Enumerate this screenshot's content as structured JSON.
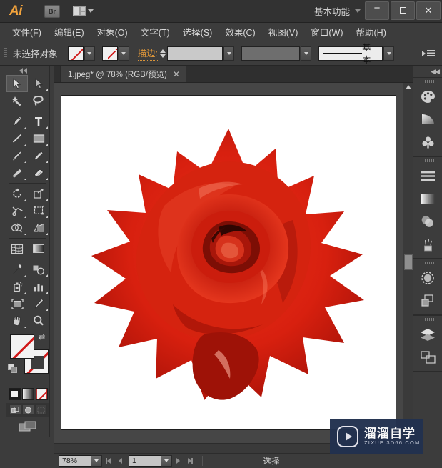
{
  "app": {
    "name": "Ai",
    "bridge_label": "Br",
    "workspace": "基本功能",
    "arrange_icon": "arrange-documents-icon",
    "window_controls": {
      "minimize": "—",
      "maximize": "□",
      "close": "✕"
    }
  },
  "menubar": {
    "items": [
      {
        "label": "文件(F)",
        "name": "menu-file"
      },
      {
        "label": "编辑(E)",
        "name": "menu-edit"
      },
      {
        "label": "对象(O)",
        "name": "menu-object"
      },
      {
        "label": "文字(T)",
        "name": "menu-type"
      },
      {
        "label": "选择(S)",
        "name": "menu-select"
      },
      {
        "label": "效果(C)",
        "name": "menu-effect"
      },
      {
        "label": "视图(V)",
        "name": "menu-view"
      },
      {
        "label": "窗口(W)",
        "name": "menu-window"
      },
      {
        "label": "帮助(H)",
        "name": "menu-help"
      }
    ]
  },
  "control_bar": {
    "selection_status": "未选择对象",
    "fill_swatch": "none",
    "stroke_swatch": "none",
    "stroke_label": "描边:",
    "stroke_weight_value": "",
    "stroke_weight_placeholder": "",
    "variable_width_value": "",
    "stroke_profile": "基本",
    "panel_menu_icon": "panel-menu-icon"
  },
  "toolbar": {
    "tools": [
      {
        "name": "selection-tool",
        "label": "选择工具",
        "selected": true
      },
      {
        "name": "direct-selection-tool",
        "label": "直接选择工具",
        "selected": false
      },
      {
        "name": "magic-wand-tool",
        "label": "魔棒工具",
        "selected": false
      },
      {
        "name": "lasso-tool",
        "label": "套索工具",
        "selected": false
      },
      {
        "name": "pen-tool",
        "label": "钢笔工具",
        "selected": false
      },
      {
        "name": "type-tool",
        "label": "文字工具",
        "selected": false
      },
      {
        "name": "line-segment-tool",
        "label": "直线段工具",
        "selected": false
      },
      {
        "name": "rectangle-tool",
        "label": "矩形工具",
        "selected": false
      },
      {
        "name": "paintbrush-tool",
        "label": "画笔工具",
        "selected": false
      },
      {
        "name": "pencil-tool",
        "label": "铅笔工具",
        "selected": false
      },
      {
        "name": "blob-brush-tool",
        "label": "斑点画笔工具",
        "selected": false
      },
      {
        "name": "eraser-tool",
        "label": "橡皮擦工具",
        "selected": false
      },
      {
        "name": "rotate-tool",
        "label": "旋转工具",
        "selected": false
      },
      {
        "name": "scale-tool",
        "label": "比例缩放工具",
        "selected": false
      },
      {
        "name": "width-tool",
        "label": "宽度工具",
        "selected": false
      },
      {
        "name": "free-transform-tool",
        "label": "自由变换工具",
        "selected": false
      },
      {
        "name": "shape-builder-tool",
        "label": "形状生成器工具",
        "selected": false
      },
      {
        "name": "perspective-grid-tool",
        "label": "透视网格工具",
        "selected": false
      },
      {
        "name": "mesh-tool",
        "label": "网格工具",
        "selected": false
      },
      {
        "name": "gradient-tool",
        "label": "渐变工具",
        "selected": false
      },
      {
        "name": "eyedropper-tool",
        "label": "吸管工具",
        "selected": false
      },
      {
        "name": "blend-tool",
        "label": "混合工具",
        "selected": false
      },
      {
        "name": "symbol-sprayer-tool",
        "label": "符号喷枪工具",
        "selected": false
      },
      {
        "name": "column-graph-tool",
        "label": "柱形图工具",
        "selected": false
      },
      {
        "name": "artboard-tool",
        "label": "画板工具",
        "selected": false
      },
      {
        "name": "slice-tool",
        "label": "切片工具",
        "selected": false
      },
      {
        "name": "hand-tool",
        "label": "抓手工具",
        "selected": false
      },
      {
        "name": "zoom-tool",
        "label": "缩放工具",
        "selected": false
      }
    ],
    "fill_state": "none",
    "stroke_state": "none",
    "swap_icon": "swap-fill-stroke-icon",
    "default_icon": "default-fill-stroke-icon",
    "color_modes": [
      {
        "name": "color-mode-button",
        "label": "颜色"
      },
      {
        "name": "gradient-mode-button",
        "label": "渐变"
      },
      {
        "name": "none-mode-button",
        "label": "无",
        "selected": true
      }
    ],
    "draw_modes": [
      {
        "name": "draw-normal-button",
        "label": "正常绘图"
      },
      {
        "name": "draw-behind-button",
        "label": "背面绘图"
      },
      {
        "name": "draw-inside-button",
        "label": "内部绘图"
      }
    ],
    "screen_mode": {
      "name": "screen-mode-button",
      "label": "更改屏幕模式"
    }
  },
  "document": {
    "tab_title": "1.jpeg* @ 78% (RGB/预览)",
    "close_glyph": "✕",
    "artboard_content": "red-rose-photo"
  },
  "status_bar": {
    "zoom_level": "78%",
    "page_number": "1",
    "status_text": "选择",
    "nav_first": "first-artboard-button",
    "nav_prev": "previous-artboard-button",
    "nav_next": "next-artboard-button",
    "nav_last": "last-artboard-button"
  },
  "dock": {
    "collapse_icon": "collapse-panels-icon",
    "groups": [
      {
        "panels": [
          {
            "name": "panel-color-icon",
            "label": "颜色"
          },
          {
            "name": "panel-color-guide-icon",
            "label": "颜色参考"
          },
          {
            "name": "panel-symbols-icon",
            "label": "符号"
          }
        ]
      },
      {
        "panels": [
          {
            "name": "panel-stroke-icon",
            "label": "描边"
          },
          {
            "name": "panel-gradient-icon",
            "label": "渐变"
          },
          {
            "name": "panel-transparency-icon",
            "label": "透明度"
          },
          {
            "name": "panel-brushes-icon",
            "label": "画笔"
          }
        ]
      },
      {
        "panels": [
          {
            "name": "panel-appearance-icon",
            "label": "外观"
          },
          {
            "name": "panel-graphic-styles-icon",
            "label": "图形样式"
          }
        ]
      },
      {
        "panels": [
          {
            "name": "panel-layers-icon",
            "label": "图层"
          },
          {
            "name": "panel-artboards-icon",
            "label": "画板"
          }
        ]
      }
    ]
  },
  "watermark": {
    "title": "溜溜自学",
    "subtitle": "ZIXUE.3D66.COM",
    "logo": "play-button-logo",
    "bg_color": "#22314f"
  },
  "colors": {
    "window_bg": "#3c3c3c",
    "titlebar_bg": "#323232",
    "canvas_bg": "#464646",
    "artboard_bg": "#ffffff",
    "accent_orange": "#f2a33c",
    "stroke_label_orange": "#d8933a",
    "none_red": "#d01818",
    "rose_red": "#d82418",
    "rose_dark": "#8c1008"
  }
}
